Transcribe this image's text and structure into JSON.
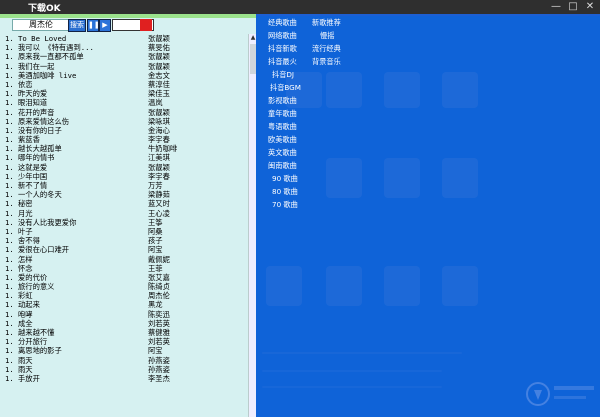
{
  "window": {
    "title": "下载OK",
    "min": "—",
    "max": "□",
    "close": "✕"
  },
  "toolbar": {
    "search_value": "周杰伦",
    "search_label": "搜索",
    "play_label": "▶",
    "pause_label": "❚❚"
  },
  "songs": [
    {
      "n": "1.",
      "t": "To Be Loved",
      "a": "张靓颖"
    },
    {
      "n": "1.",
      "t": "我可以 《特有遇到...",
      "a": "蔡旻佑"
    },
    {
      "n": "1.",
      "t": "原来我一直都不孤单",
      "a": "张靓颖"
    },
    {
      "n": "1.",
      "t": "我们在一起",
      "a": "张靓颖"
    },
    {
      "n": "1.",
      "t": "美酒加咖啡  live",
      "a": "金志文"
    },
    {
      "n": "1.",
      "t": "依恋",
      "a": "蔡淳佳"
    },
    {
      "n": "1.",
      "t": "昨天的爱",
      "a": "梁佳玉"
    },
    {
      "n": "1.",
      "t": "眼泪知道",
      "a": "温岚"
    },
    {
      "n": "1.",
      "t": "花开的声音",
      "a": "张靓颖"
    },
    {
      "n": "1.",
      "t": "原来爱情这么伤",
      "a": "梁咏琪"
    },
    {
      "n": "1.",
      "t": "没有你的日子",
      "a": "金海心"
    },
    {
      "n": "1.",
      "t": "紫蓝香",
      "a": "李宇春"
    },
    {
      "n": "1.",
      "t": "越长大越孤单",
      "a": "牛奶咖啡"
    },
    {
      "n": "1.",
      "t": "哪年的情书",
      "a": "江美琪"
    },
    {
      "n": "1.",
      "t": "这就是爱",
      "a": "张靓颖"
    },
    {
      "n": "1.",
      "t": "少年中国",
      "a": "李宇春"
    },
    {
      "n": "1.",
      "t": "新不了情",
      "a": "万芳"
    },
    {
      "n": "1.",
      "t": "一个人的冬天",
      "a": "梁静茹"
    },
    {
      "n": "1.",
      "t": "秘密",
      "a": "蓝又时"
    },
    {
      "n": "1.",
      "t": "月光",
      "a": "王心凌"
    },
    {
      "n": "1.",
      "t": "没有人比我更爱你",
      "a": "王筝"
    },
    {
      "n": "1.",
      "t": "叶子",
      "a": "阿桑"
    },
    {
      "n": "1.",
      "t": "舍不得",
      "a": "孩子"
    },
    {
      "n": "1.",
      "t": "爱很在心口难开",
      "a": "阿宝"
    },
    {
      "n": "1.",
      "t": "怎样",
      "a": "戴佩妮"
    },
    {
      "n": "1.",
      "t": "怀念",
      "a": "王菲"
    },
    {
      "n": "1.",
      "t": "爱的代价",
      "a": "张艾嘉"
    },
    {
      "n": "1.",
      "t": "旅行的意义",
      "a": "陈绮贞"
    },
    {
      "n": "1.",
      "t": "彩虹",
      "a": "周杰伦"
    },
    {
      "n": "1.",
      "t": "动起来",
      "a": "黑龙"
    },
    {
      "n": "1.",
      "t": "咆哮",
      "a": "陈奕迅"
    },
    {
      "n": "1.",
      "t": "成全",
      "a": "刘若英"
    },
    {
      "n": "1.",
      "t": "越来越不懂",
      "a": "蔡健雅"
    },
    {
      "n": "1.",
      "t": "分开旅行",
      "a": "刘若英"
    },
    {
      "n": "1.",
      "t": "离思地的影子",
      "a": "阿宝"
    },
    {
      "n": "1.",
      "t": "雨天",
      "a": "孙燕姿"
    },
    {
      "n": "1.",
      "t": "雨天",
      "a": "孙燕姿"
    },
    {
      "n": "1.",
      "t": "手放开",
      "a": "李圣杰"
    }
  ],
  "categories": [
    {
      "label": "经典歌曲"
    },
    {
      "label": "新歌推荐"
    },
    {
      "label": "网络歌曲"
    },
    {
      "label": "慢摇"
    },
    {
      "label": "抖音新歌"
    },
    {
      "label": "流行经典"
    },
    {
      "label": "抖音最火"
    },
    {
      "label": "背景音乐"
    },
    {
      "label": "抖音DJ"
    },
    {
      "label": "抖音BGM"
    },
    {
      "label": "影视歌曲"
    },
    {
      "label": "童年歌曲"
    },
    {
      "label": "粤语歌曲"
    },
    {
      "label": "欧美歌曲"
    },
    {
      "label": "英文歌曲"
    },
    {
      "label": "闽南歌曲"
    },
    {
      "label": "90 歌曲"
    },
    {
      "label": "80 歌曲"
    },
    {
      "label": "70 歌曲"
    }
  ],
  "colors": {
    "left_bg": "#d6f1f1",
    "right_bg": "#0f63d8",
    "accent": "#9be28c",
    "titlebar": "#2f2f2f"
  }
}
